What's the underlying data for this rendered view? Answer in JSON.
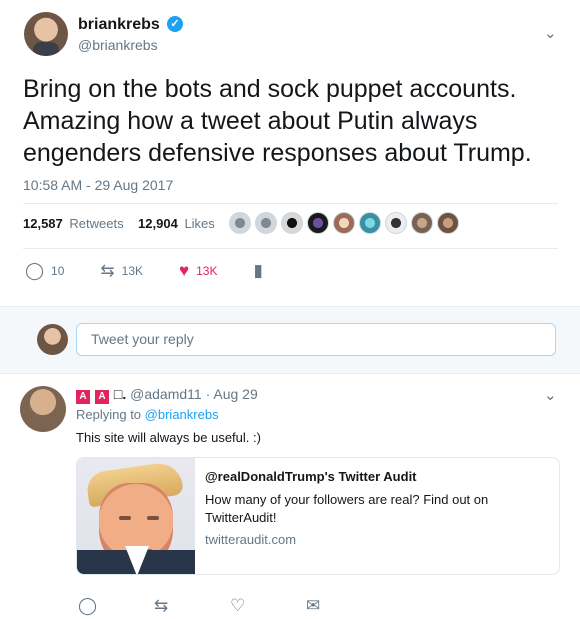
{
  "tweet": {
    "author_name": "briankrebs",
    "author_handle": "@briankrebs",
    "verified_icon": "verified-badge-icon",
    "text": "Bring on the bots and sock puppet accounts. Amazing how a tweet about Putin always engenders defensive responses about Trump.",
    "timestamp": "10:58 AM - 29 Aug 2017",
    "retweets_count": "12,587",
    "retweets_label": "Retweets",
    "likes_count": "12,904",
    "likes_label": "Likes",
    "actions": {
      "reply_count": "10",
      "retweet_count": "13K",
      "like_count": "13K"
    }
  },
  "reply_box": {
    "placeholder": "Tweet your reply"
  },
  "reply": {
    "name_text": " □.",
    "handle": "@adamd11",
    "time": "Aug 29",
    "replying_label": "Replying to",
    "replying_handle": "@briankrebs",
    "text": "This site will always be useful. :)",
    "card": {
      "title": "@realDonaldTrump's Twitter Audit",
      "description": "How many of your followers are real? Find out on TwitterAudit!",
      "domain": "twitteraudit.com"
    }
  },
  "colors": {
    "accent": "#1da1f2",
    "like": "#e0245e",
    "muted": "#657786"
  }
}
